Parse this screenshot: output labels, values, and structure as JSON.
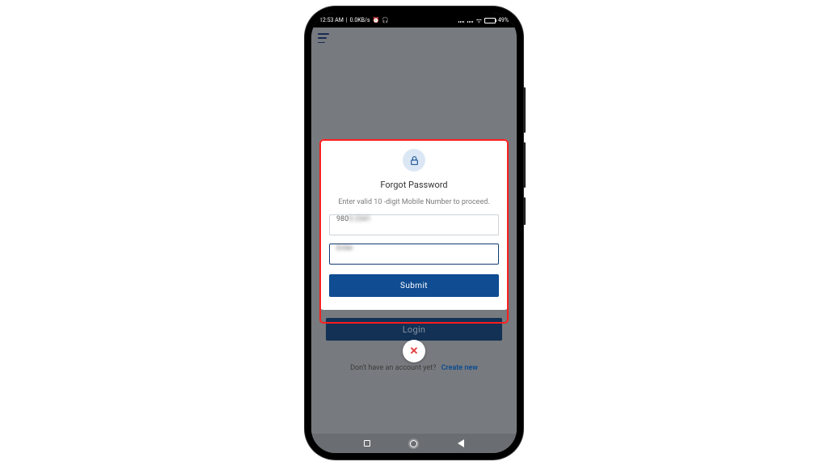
{
  "status_bar": {
    "time": "12:53 AM",
    "net_speed": "0.0KB/s",
    "battery_percent": "49%"
  },
  "modal": {
    "title": "Forgot Password",
    "subtitle": "Enter valid 10 -digit Mobile Number to proceed.",
    "field1_value": "980",
    "field2_value": "",
    "submit_label": "Submit"
  },
  "background": {
    "login_label": "Login",
    "prompt_text": "Don't have an account yet?",
    "link_text": "Create new"
  }
}
